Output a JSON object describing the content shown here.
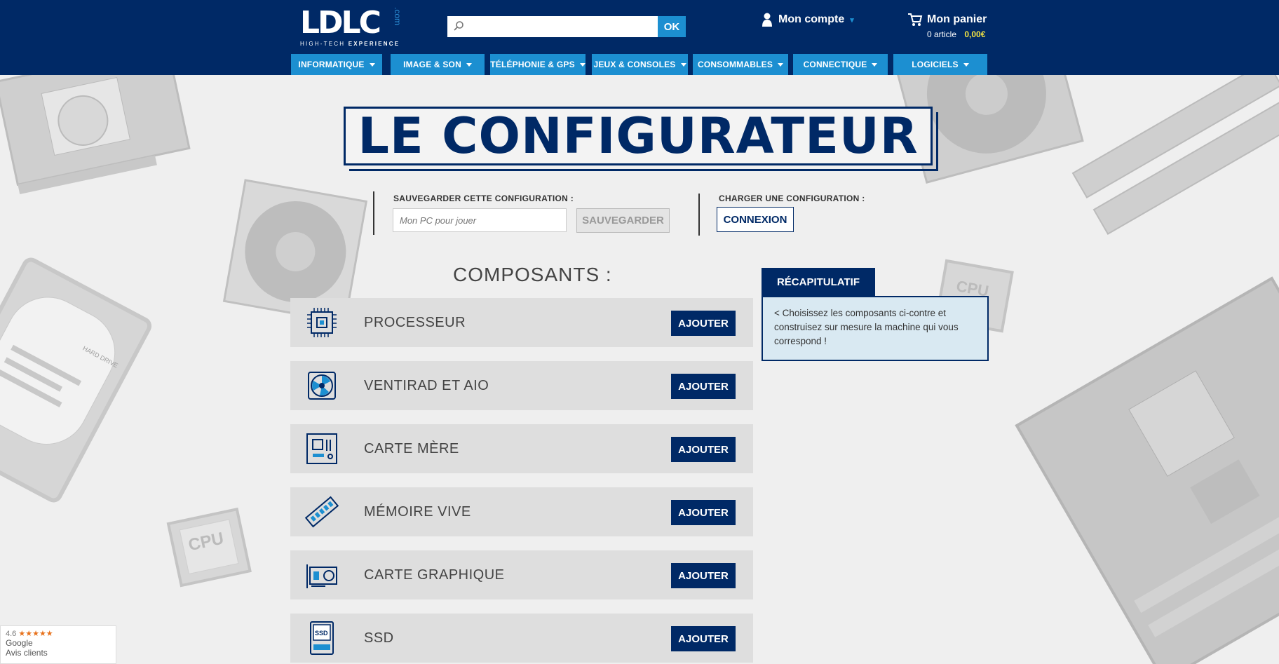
{
  "header": {
    "logo_text": "LDLC",
    "logo_com": ".com",
    "logo_tagline_1": "HIGH-TECH",
    "logo_tagline_2": "EXPERIENCE",
    "search_placeholder": "",
    "search_button": "OK",
    "account_label": "Mon compte",
    "cart_label": "Mon panier",
    "cart_count": "0 article",
    "cart_total": "0,00€"
  },
  "nav": [
    {
      "label": "INFORMATIQUE"
    },
    {
      "label": "IMAGE & SON"
    },
    {
      "label": "TÉLÉPHONIE & GPS"
    },
    {
      "label": "JEUX & CONSOLES"
    },
    {
      "label": "CONSOMMABLES"
    },
    {
      "label": "CONNECTIQUE"
    },
    {
      "label": "LOGICIELS"
    }
  ],
  "page": {
    "title": "LE CONFIGURATEUR",
    "save_label": "SAUVEGARDER CETTE CONFIGURATION :",
    "save_placeholder": "Mon PC pour jouer",
    "save_button": "SAUVEGARDER",
    "load_label": "CHARGER UNE CONFIGURATION :",
    "load_button": "CONNEXION",
    "components_title": "COMPOSANTS :"
  },
  "components": [
    {
      "label": "PROCESSEUR",
      "button": "AJOUTER",
      "icon": "processor-icon"
    },
    {
      "label": "VENTIRAD ET AIO",
      "button": "AJOUTER",
      "icon": "fan-icon"
    },
    {
      "label": "CARTE MÈRE",
      "button": "AJOUTER",
      "icon": "motherboard-icon"
    },
    {
      "label": "MÉMOIRE VIVE",
      "button": "AJOUTER",
      "icon": "ram-icon"
    },
    {
      "label": "CARTE GRAPHIQUE",
      "button": "AJOUTER",
      "icon": "graphics-card-icon"
    },
    {
      "label": "SSD",
      "button": "AJOUTER",
      "icon": "ssd-icon"
    }
  ],
  "recap": {
    "tab": "RÉCAPITULATIF",
    "text": "< Choisissez les composants ci-contre et construisez sur mesure la machine qui vous correspond !"
  },
  "google_badge": {
    "rating": "4.6",
    "stars": "★★★★★",
    "line1": "Google",
    "line2": "Avis clients"
  },
  "decor": {
    "cpu_label": "CPU",
    "hdd_label": "HARD DRIVE"
  },
  "colors": {
    "navy": "#002966",
    "accent_blue": "#1c8fd1",
    "price_yellow": "#f4e542",
    "recap_bg": "#d9e9f2"
  }
}
